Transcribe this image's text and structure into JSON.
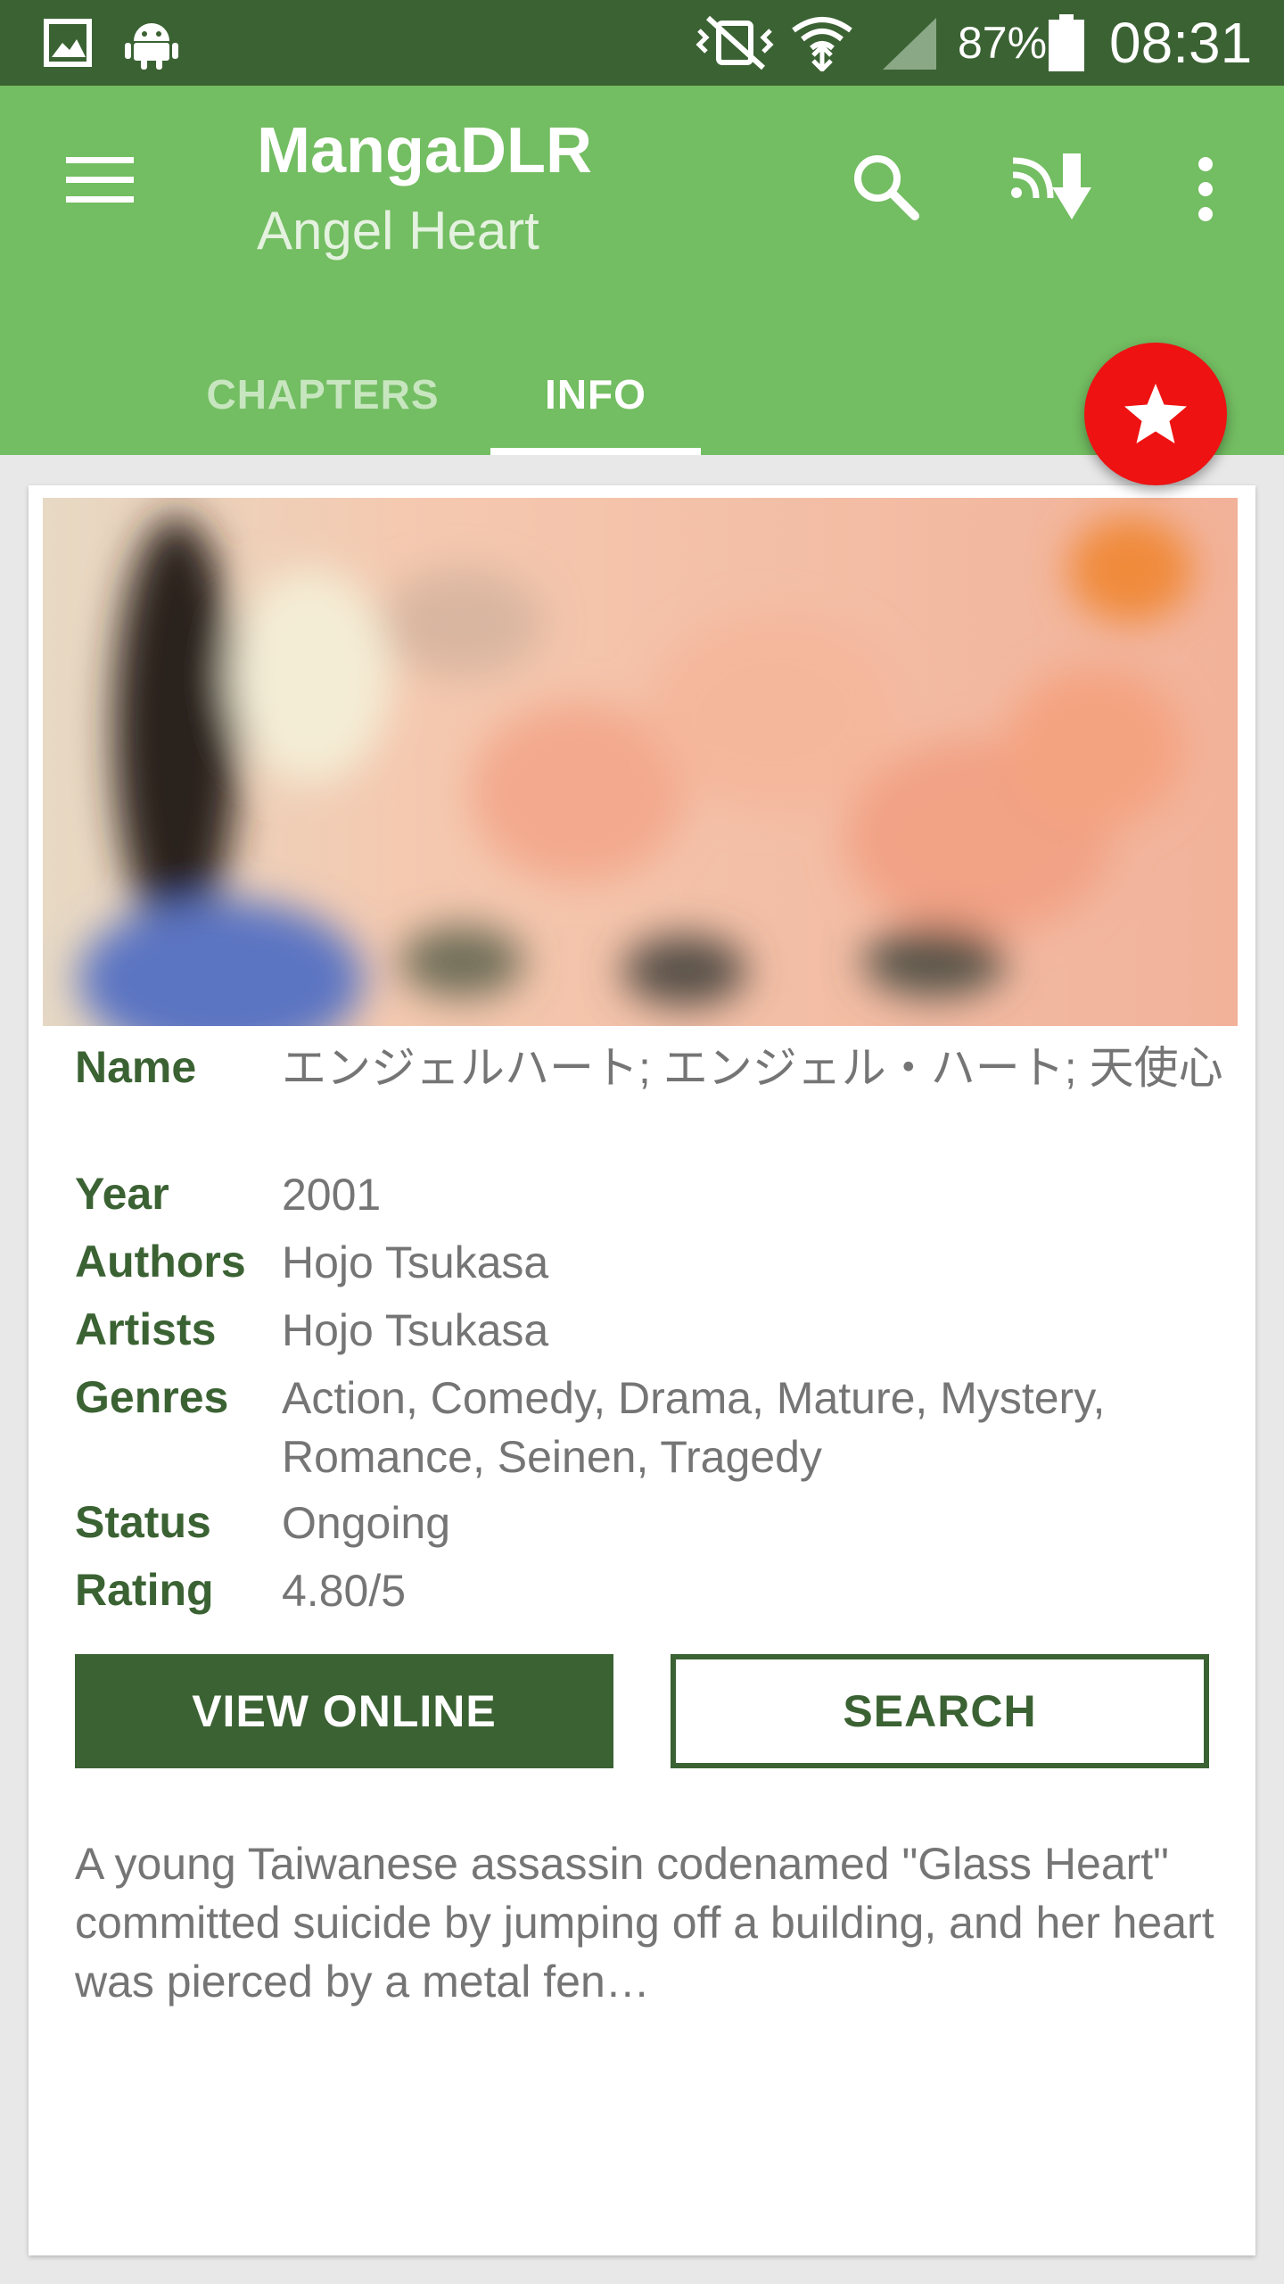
{
  "status_bar": {
    "battery_percent": "87%",
    "time": "08:31"
  },
  "app_bar": {
    "title": "MangaDLR",
    "subtitle": "Angel Heart",
    "background_color": "#73bd62"
  },
  "tabs": [
    {
      "label": "CHAPTERS",
      "selected": false
    },
    {
      "label": "INFO",
      "selected": true
    }
  ],
  "fab": {
    "icon": "star-icon",
    "color": "#ee1212"
  },
  "manga_info": {
    "rows": [
      {
        "label": "Name",
        "value": "エンジェルハート; エンジェル・ハート; 天使心"
      },
      {
        "label": "Year",
        "value": "2001"
      },
      {
        "label": "Authors",
        "value": "Hojo Tsukasa"
      },
      {
        "label": "Artists",
        "value": "Hojo Tsukasa"
      },
      {
        "label": "Genres",
        "value": "Action, Comedy, Drama, Mature, Mystery, Romance, Seinen, Tragedy"
      },
      {
        "label": "Status",
        "value": "Ongoing"
      },
      {
        "label": "Rating",
        "value": "4.80/5"
      }
    ],
    "label_color": "#3b6233"
  },
  "buttons": {
    "view_online": "VIEW ONLINE",
    "search": "SEARCH"
  },
  "description": "A young Taiwanese assassin codenamed \"Glass Heart\" committed suicide by jumping off a building, and her heart was pierced by a metal fen…"
}
